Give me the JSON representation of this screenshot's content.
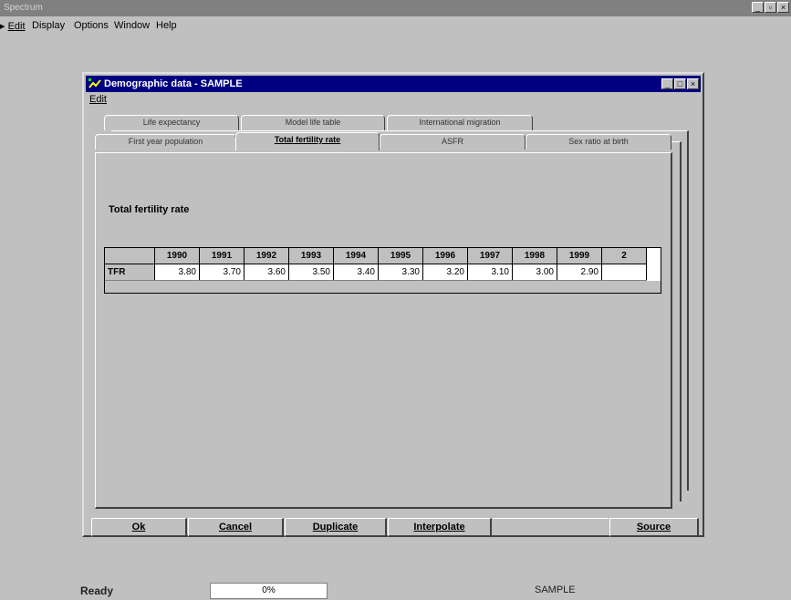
{
  "app": {
    "title": "Spectrum",
    "menu": [
      "Edit",
      "Display",
      "Options",
      "Window",
      "Help"
    ]
  },
  "dialog": {
    "title": "Demographic data - SAMPLE",
    "menu_edit": "Edit",
    "tabs_back": [
      "Life expectancy",
      "Model life table",
      "International migration"
    ],
    "tabs_front": [
      "First year population",
      "Total fertility rate",
      "ASFR",
      "Sex ratio at birth"
    ],
    "active_tab": "Total fertility rate",
    "section_title": "Total fertility rate",
    "grid": {
      "years": [
        "1990",
        "1991",
        "1992",
        "1993",
        "1994",
        "1995",
        "1996",
        "1997",
        "1998",
        "1999",
        "2"
      ],
      "row_label": "TFR",
      "values": [
        "3.80",
        "3.70",
        "3.60",
        "3.50",
        "3.40",
        "3.30",
        "3.20",
        "3.10",
        "3.00",
        "2.90",
        ""
      ]
    },
    "buttons": {
      "ok": "Ok",
      "cancel": "Cancel",
      "duplicate": "Duplicate",
      "interpolate": "Interpolate",
      "source": "Source"
    }
  },
  "status": {
    "ready": "Ready",
    "percent": "0%",
    "project": "SAMPLE"
  },
  "colors": {
    "title_active": "#000080",
    "title_inactive": "#808080",
    "face": "#c0c0c0"
  }
}
